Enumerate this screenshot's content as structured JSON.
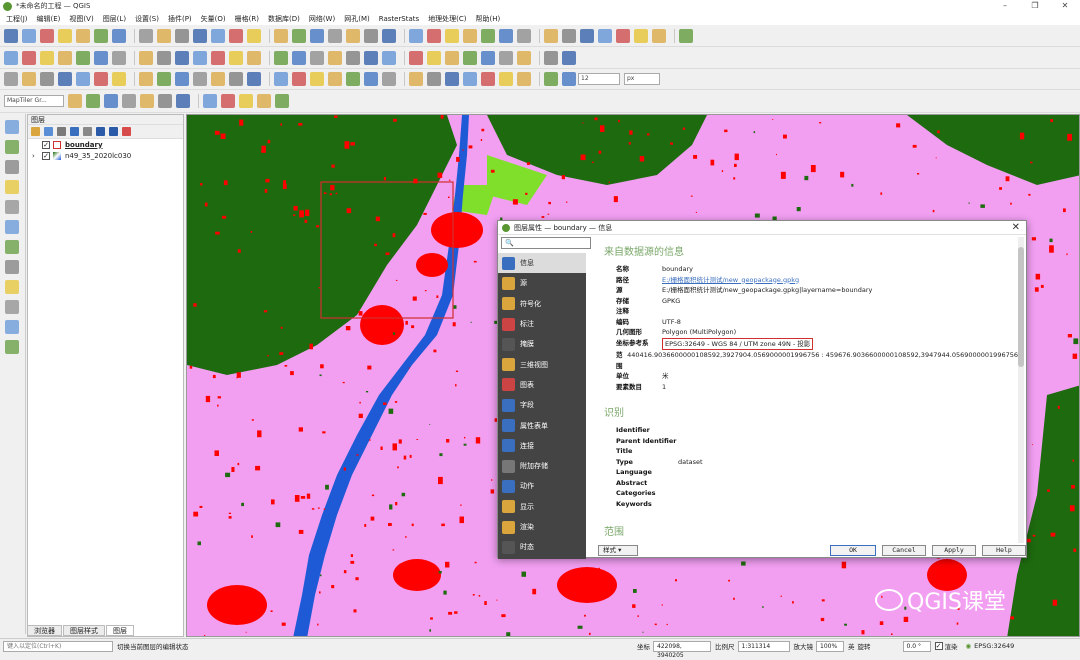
{
  "window": {
    "title": "*未命名的工程 — QGIS",
    "controls": [
      "–",
      "❐",
      "✕"
    ]
  },
  "menu": [
    "工程(J)",
    "编辑(E)",
    "视图(V)",
    "图层(L)",
    "设置(S)",
    "插件(P)",
    "矢量(O)",
    "栅格(R)",
    "数据库(D)",
    "网络(W)",
    "网孔(M)",
    "RasterStats",
    "地理处理(C)",
    "帮助(H)"
  ],
  "toolbar": {
    "label_size": "12",
    "label_unit": "px",
    "locator_placeholder": "MapTiler Gr..."
  },
  "layers_panel": {
    "title": "图层",
    "layers": [
      {
        "name": "boundary",
        "checked": true,
        "color": "#d12e2e"
      },
      {
        "name": "n49_35_2020lc030",
        "checked": true,
        "color": "#666"
      }
    ],
    "tabs": [
      "浏览器",
      "图层样式",
      "图层"
    ]
  },
  "dialog": {
    "title": "图层属性 — boundary — 信息",
    "search_placeholder": "",
    "nav": [
      "信息",
      "源",
      "符号化",
      "标注",
      "掩膜",
      "三维视图",
      "图表",
      "字段",
      "属性表单",
      "连接",
      "附加存储",
      "动作",
      "显示",
      "渲染",
      "时态"
    ],
    "source_section": {
      "heading": "来自数据源的信息",
      "rows": [
        {
          "k": "名称",
          "v": "boundary"
        },
        {
          "k": "路径",
          "v": "E:/栅格面积统计测试/new_geopackage.gpkg"
        },
        {
          "k": "源",
          "v": "E:/栅格面积统计测试/new_geopackage.gpkg|layername=boundary"
        },
        {
          "k": "存储",
          "v": "GPKG"
        },
        {
          "k": "注释",
          "v": ""
        },
        {
          "k": "编码",
          "v": "UTF-8"
        },
        {
          "k": "几何图形",
          "v": "Polygon (MultiPolygon)"
        },
        {
          "k": "坐标参考系",
          "v": "EPSG:32649 - WGS 84 / UTM zone 49N - 投影"
        },
        {
          "k": "范围",
          "v": "440416.9036600000108592,3927904.0569000001996756 : 459676.9036600000108592,3947944.0569000001996756"
        },
        {
          "k": "单位",
          "v": "米"
        },
        {
          "k": "要素数目",
          "v": "1"
        }
      ]
    },
    "ident_section": {
      "heading": "识别",
      "rows": [
        {
          "k": "Identifier",
          "v": ""
        },
        {
          "k": "Parent Identifier",
          "v": ""
        },
        {
          "k": "Title",
          "v": ""
        },
        {
          "k": "Type",
          "v": "dataset"
        },
        {
          "k": "Language",
          "v": ""
        },
        {
          "k": "Abstract",
          "v": ""
        },
        {
          "k": "Categories",
          "v": ""
        },
        {
          "k": "Keywords",
          "v": ""
        }
      ]
    },
    "extent_heading": "范围",
    "style_button": "样式",
    "buttons": {
      "ok": "OK",
      "cancel": "Cancel",
      "apply": "Apply",
      "help": "Help"
    }
  },
  "status": {
    "locator_placeholder": "键入以定位(Ctrl+K)",
    "message": "切换当前图层的编辑状态",
    "coord_label": "坐标",
    "coord_value": "422098, 3940205",
    "scale_label": "比例尺",
    "scale_value": "1:311314",
    "magnifier_label": "放大镜",
    "magnifier_value": "100%",
    "rotation_label": "旋转",
    "rotation_value": "0.0 °",
    "render_label": "渲染",
    "crs": "EPSG:32649",
    "ime": "英"
  },
  "watermark": "QGIS课堂",
  "colors": {
    "map_bg": "#f29ff2",
    "forest": "#1e6b0f",
    "water": "#1f5ad6",
    "urban": "#ff0000",
    "grass": "#7fdf2a",
    "accent": "#589632"
  }
}
